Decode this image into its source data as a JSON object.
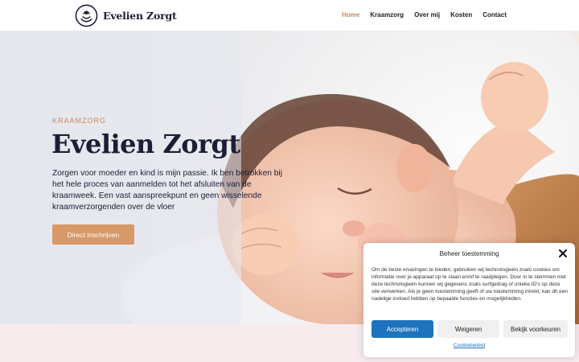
{
  "header": {
    "brand": "Evelien Zorgt",
    "nav": [
      {
        "label": "Home",
        "active": true
      },
      {
        "label": "Kraamzorg",
        "active": false
      },
      {
        "label": "Over mij",
        "active": false
      },
      {
        "label": "Kosten",
        "active": false
      },
      {
        "label": "Contact",
        "active": false
      }
    ]
  },
  "hero": {
    "kicker": "KRAAMZORG",
    "title": "Evelien Zorgt",
    "text": "Zorgen voor moeder en kind is mijn passie. Ik ben betrokken bij het hele proces van aanmelden tot het afsluiten van de kraamweek. Een vast aanspreekpunt en geen wisselende kraamverzorgenden over de vloer",
    "cta_label": "Direct inschrijven"
  },
  "consent": {
    "title": "Beheer toestemming",
    "body": "Om de beste ervaringen te bieden, gebruiken wij technologieën zoals cookies om informatie over je apparaat op te slaan en/of te raadplegen. Door in te stemmen met deze technologieën kunnen wij gegevens zoals surfgedrag of unieke ID's op deze site verwerken. Als je geen toestemming geeft of uw toestemming intrekt, kan dit een nadelige invloed hebben op bepaalde functies en mogelijkheden.",
    "accept_label": "Accepteren",
    "deny_label": "Weigeren",
    "prefs_label": "Bekijk voorkeuren",
    "policy_label": "Cookiebeleid"
  },
  "colors": {
    "accent": "#c98a5a",
    "cta": "#d69967",
    "accept": "#1e73be",
    "dark": "#1d1d35",
    "band": "#f7ebee"
  },
  "icons": {
    "logo": "mother-child-logo-icon",
    "close": "close-icon"
  }
}
